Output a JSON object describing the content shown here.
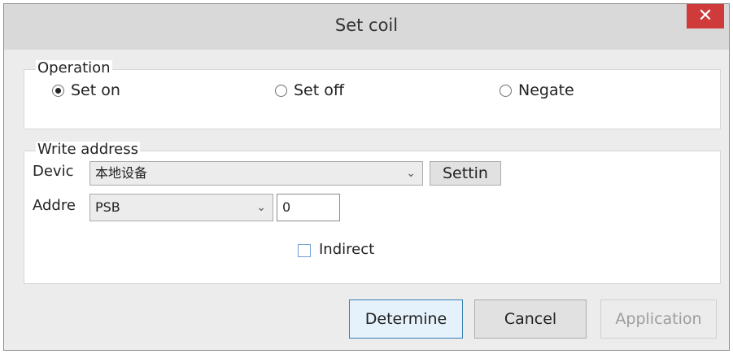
{
  "window": {
    "title": "Set coil",
    "close_glyph": "✕"
  },
  "operation": {
    "legend": "Operation",
    "options": [
      {
        "label": "Set on",
        "checked": true
      },
      {
        "label": "Set off",
        "checked": false
      },
      {
        "label": "Negate",
        "checked": false
      }
    ]
  },
  "write_address": {
    "legend": "Write address",
    "device_label": "Devic",
    "device_value": "本地设备",
    "settings_button": "Settin",
    "address_label": "Addre",
    "address_type": "PSB",
    "address_value": "0",
    "indirect_label": "Indirect",
    "indirect_checked": false
  },
  "buttons": {
    "determine": "Determine",
    "cancel": "Cancel",
    "application": "Application"
  },
  "colors": {
    "close_bg": "#cf3b3b",
    "default_button_border": "#3c7fb1"
  }
}
